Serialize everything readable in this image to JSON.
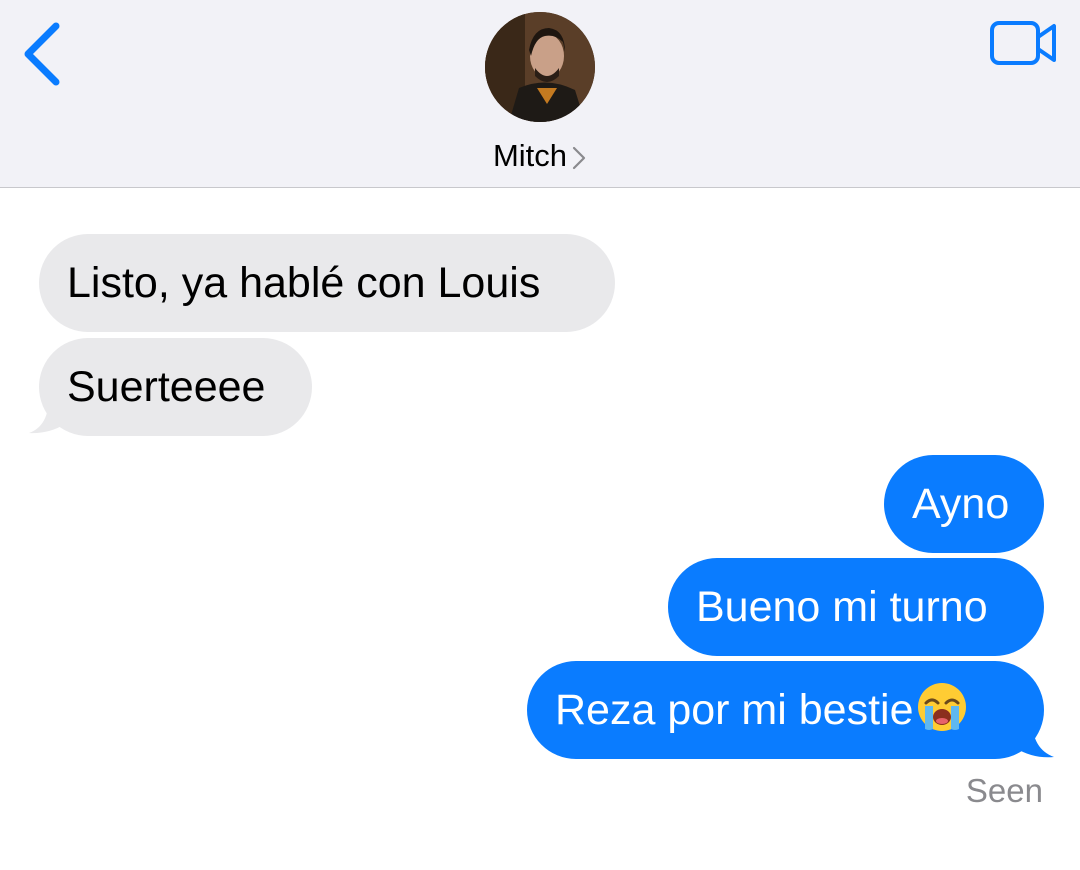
{
  "header": {
    "contact_name": "Mitch",
    "back_icon": "chevron-left-icon",
    "video_icon": "video-camera-icon"
  },
  "messages": [
    {
      "direction": "incoming",
      "text": "Listo, ya hablé con Louis"
    },
    {
      "direction": "incoming",
      "text": "Suerteeee"
    },
    {
      "direction": "outgoing",
      "text": "Ayno"
    },
    {
      "direction": "outgoing",
      "text": "Bueno mi turno"
    },
    {
      "direction": "outgoing",
      "text": "Reza por mi bestie",
      "emoji": "loudly-crying-face"
    }
  ],
  "status": {
    "read_receipt": "Seen"
  },
  "colors": {
    "accent": "#0a7cff",
    "incoming_bubble": "#e9e9eb",
    "header_bg": "#f2f2f7"
  }
}
